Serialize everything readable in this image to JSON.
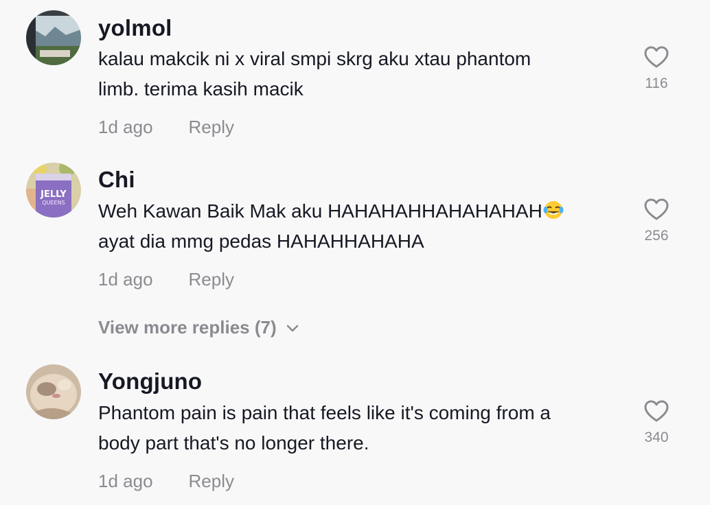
{
  "comments": [
    {
      "username": "yolmol",
      "lines": [
        "kalau makcik ni x viral smpi skrg aku xtau phantom",
        "limb. terima kasih macik"
      ],
      "time": "1d ago",
      "reply_label": "Reply",
      "likes": "116",
      "avatar": "landscape-photo"
    },
    {
      "username": "Chi",
      "lines": [
        "Weh Kawan Baik Mak aku HAHAHAHHAHAHAHAH",
        "ayat dia mmg pedas HAHAHHAHAHA"
      ],
      "emoji": "tears-of-joy-emoji",
      "time": "1d ago",
      "reply_label": "Reply",
      "likes": "256",
      "avatar": "jelly-jar-photo",
      "avatar_text": [
        "JELLY",
        "QUEENS"
      ]
    },
    {
      "username": "Yongjuno",
      "lines": [
        "Phantom pain is pain that feels like it's coming from a",
        "body part that's no longer there."
      ],
      "time": "1d ago",
      "reply_label": "Reply",
      "likes": "340",
      "avatar": "cat-photo"
    }
  ],
  "view_more": {
    "label": "View more replies (7)",
    "icon": "chevron-down-icon"
  },
  "colors": {
    "background": "#f8f8f8",
    "primary_text": "#161823",
    "secondary_text": "#8a8b91"
  }
}
